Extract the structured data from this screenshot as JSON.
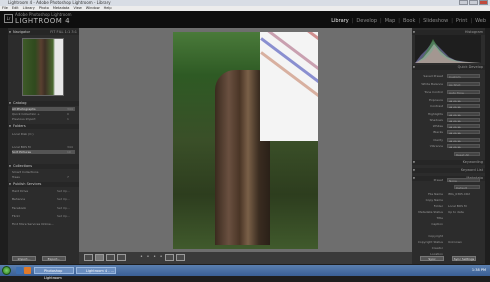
{
  "window": {
    "title": "Lightroom 4 - Adobe Photoshop Lightroom - Library"
  },
  "menu": [
    "File",
    "Edit",
    "Library",
    "Photo",
    "Metadata",
    "View",
    "Window",
    "Help"
  ],
  "app": {
    "brand": "Adobe Photoshop Lightroom",
    "name": "LIGHTROOM 4",
    "logo": "Lr"
  },
  "modules": {
    "items": [
      "Library",
      "Develop",
      "Map",
      "Book",
      "Slideshow",
      "Print",
      "Web"
    ],
    "active": "Library",
    "separator": "|"
  },
  "left": {
    "navigator": {
      "label": "Navigator",
      "zoom": "FIT  FILL  1:1  3:1"
    },
    "catalog": {
      "label": "Catalog",
      "items": [
        {
          "label": "All Photographs",
          "count": "344"
        },
        {
          "label": "Quick Collection +",
          "count": "0"
        },
        {
          "label": "Previous Import",
          "count": "1"
        }
      ]
    },
    "folders": {
      "label": "Folders",
      "volume": "Local Disk (C:)",
      "items": [
        {
          "label": "Local BOS M",
          "count": "344"
        },
        {
          "label": "Sort Pictures",
          "count": "10"
        }
      ]
    },
    "collections": {
      "label": "Collections",
      "items": [
        {
          "label": "Smart Collections",
          "count": ""
        },
        {
          "label": "Trees",
          "count": "7"
        }
      ]
    },
    "publish": {
      "label": "Publish Services",
      "items": [
        {
          "label": "Hard Drive",
          "count": "Set Up..."
        },
        {
          "label": "Behance",
          "count": "Set Up..."
        },
        {
          "label": "Facebook",
          "count": "Set Up..."
        },
        {
          "label": "Flickr",
          "count": "Set Up..."
        },
        {
          "label": "Find More Services Online...",
          "count": ""
        }
      ]
    },
    "import_label": "Import...",
    "export_label": "Export..."
  },
  "right": {
    "histogram": {
      "label": "Histogram"
    },
    "quick_develop": {
      "label": "Quick Develop",
      "rows": [
        {
          "label": "Saved Preset",
          "value": "Custom"
        },
        {
          "label": "White Balance",
          "value": "As Shot"
        },
        {
          "label": "Tone Control",
          "value": "Auto Tone"
        },
        {
          "label": "Exposure",
          "value": "◂◂ ◂ ▸ ▸▸"
        },
        {
          "label": "Contrast",
          "value": "◂◂ ◂ ▸ ▸▸"
        },
        {
          "label": "Highlights",
          "value": "◂◂ ◂ ▸ ▸▸"
        },
        {
          "label": "Shadows",
          "value": "◂◂ ◂ ▸ ▸▸"
        },
        {
          "label": "Whites",
          "value": "◂◂ ◂ ▸ ▸▸"
        },
        {
          "label": "Blacks",
          "value": "◂◂ ◂ ▸ ▸▸"
        },
        {
          "label": "Clarity",
          "value": "◂◂ ◂ ▸ ▸▸"
        },
        {
          "label": "Vibrance",
          "value": "◂◂ ◂ ▸ ▸▸"
        }
      ],
      "reset_label": "Reset All"
    },
    "keywording": {
      "label": "Keywording"
    },
    "keyword_list": {
      "label": "Keyword List"
    },
    "metadata": {
      "label": "Metadata",
      "preset_label": "Default",
      "rows": [
        {
          "label": "Preset",
          "value": "None"
        },
        {
          "label": "File Name",
          "value": "IMG_0365.CR2"
        },
        {
          "label": "Copy Name",
          "value": ""
        },
        {
          "label": "Folder",
          "value": "Local BOS M"
        },
        {
          "label": "Metadata Status",
          "value": "Up to date"
        },
        {
          "label": "Title",
          "value": ""
        },
        {
          "label": "Caption",
          "value": ""
        },
        {
          "label": "Copyright",
          "value": ""
        },
        {
          "label": "Copyright Status",
          "value": "Unknown"
        },
        {
          "label": "Creator",
          "value": ""
        },
        {
          "label": "Location",
          "value": ""
        }
      ]
    },
    "sync_label": "Sync",
    "sync_settings_label": "Sync Settings"
  },
  "taskbar": {
    "items": [
      "Photoshop Lightroom",
      "Lightroom 4 - ..."
    ],
    "clock": "1:38 PM"
  }
}
